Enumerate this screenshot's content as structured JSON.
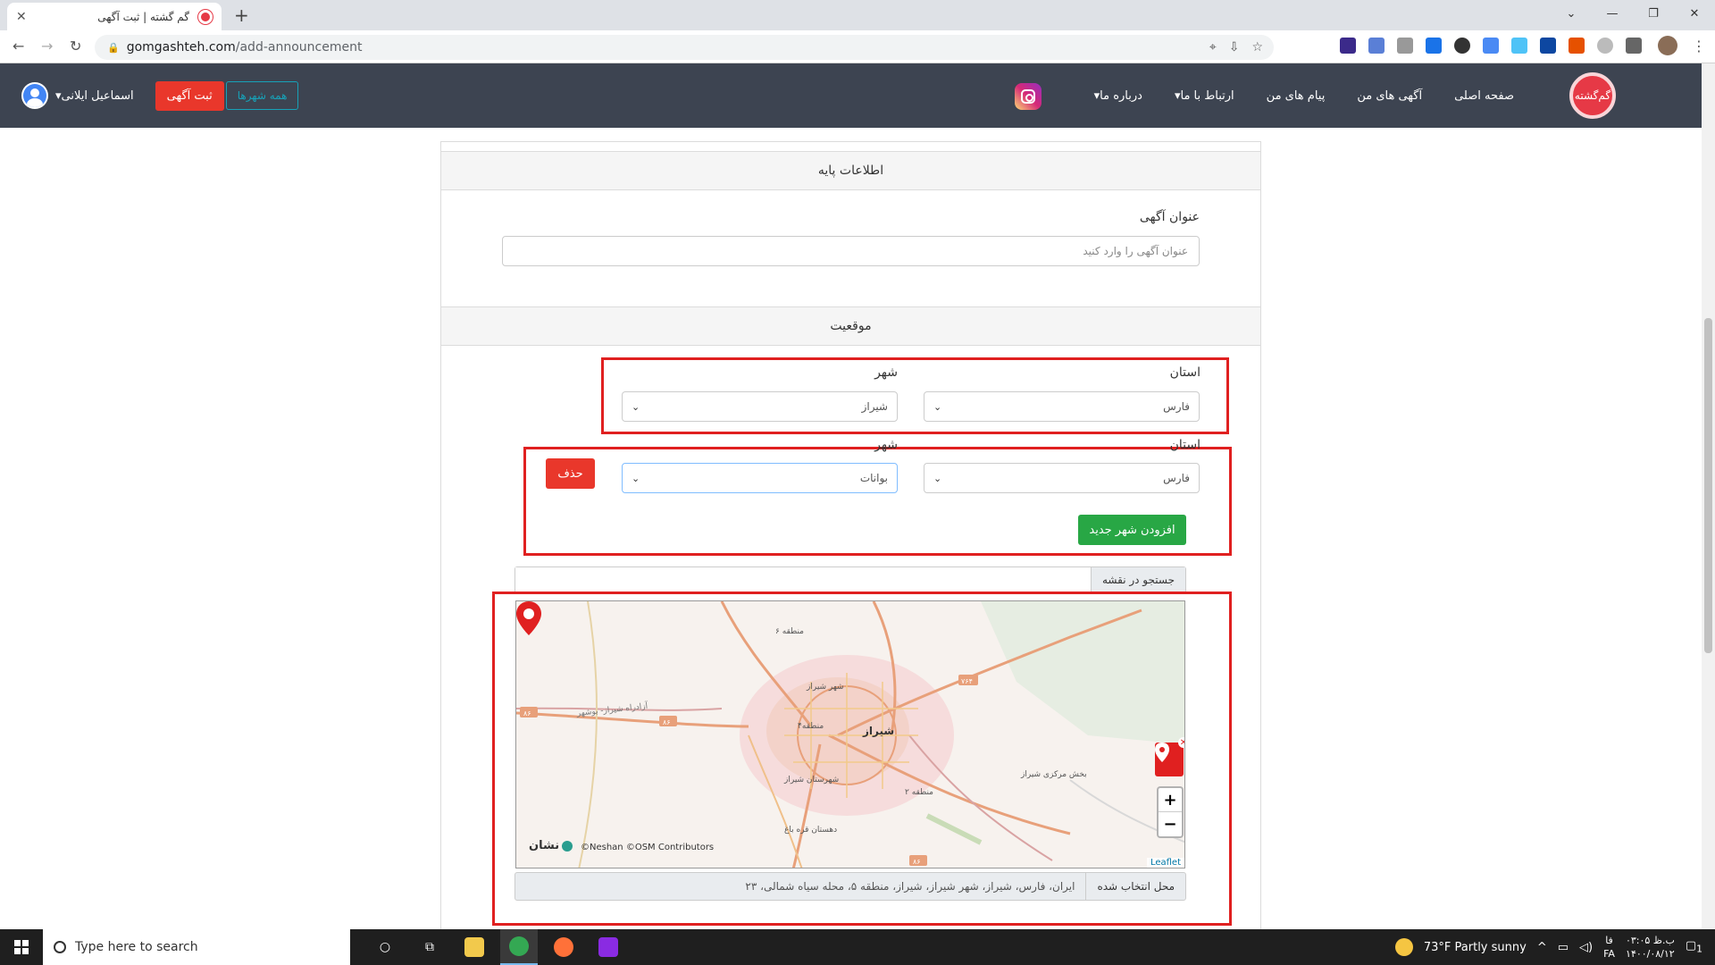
{
  "browser": {
    "tab_title": "گم گشته | ثبت آگهی",
    "url_domain": "gomgashteh.com",
    "url_path": "/add-announcement",
    "new_tab": "+",
    "tab_close": "✕"
  },
  "nav": {
    "links": [
      "صفحه اصلی",
      "آگهی های من",
      "پیام های من",
      "ارتباط با ما▾",
      "درباره ما▾"
    ],
    "logo_text": "گم‌گشته",
    "user_name": "اسماعیل ایلانی",
    "user_caret": "▾",
    "post_ad": "ثبت آگهی",
    "all_cities": "همه شهرها"
  },
  "form": {
    "section_basic": "اطلاعات پایه",
    "title_label": "عنوان آگهی",
    "title_placeholder": "عنوان آگهی را وارد کنید",
    "section_location": "موقعیت",
    "rows": [
      {
        "province_label": "استان",
        "city_label": "شهر",
        "province": "فارس",
        "city": "شیراز"
      },
      {
        "province_label": "استان",
        "city_label": "شهر",
        "province": "فارس",
        "city": "بوانات"
      }
    ],
    "delete": "حذف",
    "add_city": "افزودن شهر جدید",
    "map_search": "جستجو در نقشه",
    "selected_label": "محل انتخاب شده",
    "selected_address": "ایران، فارس، شیراز، شهر شیراز، شیراز، منطقه ۵، محله سیاه شمالی، ۲۳"
  },
  "map": {
    "city_label": "شیراز",
    "place_labels": [
      "منطقه ۶",
      "شهر شیراز",
      "منطقه۴",
      "شهرستان شیراز",
      "دهستان قره باغ",
      "منطقه ۲",
      "بخش مرکزی شیراز"
    ],
    "road_labels": [
      "۷۶۴",
      "۸۶",
      "۸۶",
      "۸۶",
      "آزادراه شیراز- بوشهر"
    ],
    "zoom_in": "+",
    "zoom_out": "−",
    "attribution": "©Neshan ©OSM Contributors",
    "brand": "نشان",
    "leaflet": "Leaflet"
  },
  "taskbar": {
    "search_placeholder": "Type here to search",
    "weather": "73°F  Partly sunny",
    "lang_fa": "فا",
    "lang_code": "FA",
    "time": "ب.ظ ۰۳:۰۵",
    "date": "۱۴۰۰/۰۸/۱۲",
    "notif_count": "1"
  },
  "colors": {
    "nav_bg": "#3d4451",
    "accent_red": "#e9372b",
    "accent_green": "#28a745",
    "accent_teal": "#17a2b8",
    "highlight_box": "#e02020"
  }
}
